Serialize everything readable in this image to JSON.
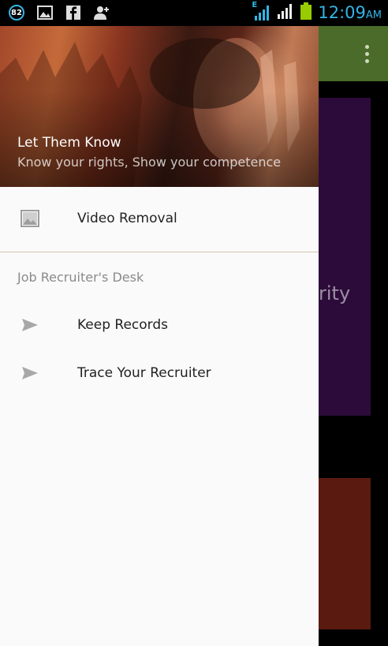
{
  "status_bar": {
    "notification_count": "82",
    "network_type": "E",
    "time": "12:09",
    "ampm": "AM",
    "accent": "#33b5e5"
  },
  "drawer": {
    "header": {
      "title": "Let Them Know",
      "subtitle": "Know your rights, Show your competence"
    },
    "items": [
      {
        "label": "Video Removal",
        "icon": "image-icon"
      }
    ],
    "section": {
      "title": "Job Recruiter's Desk",
      "items": [
        {
          "label": "Keep Records",
          "icon": "send-icon"
        },
        {
          "label": "Trace Your Recruiter",
          "icon": "send-icon"
        }
      ]
    }
  },
  "background_app": {
    "partial_text": "rity",
    "colors": {
      "actionbar": "#4a6b29",
      "card1": "#2c0b3a",
      "card2": "#5a1a10"
    }
  }
}
